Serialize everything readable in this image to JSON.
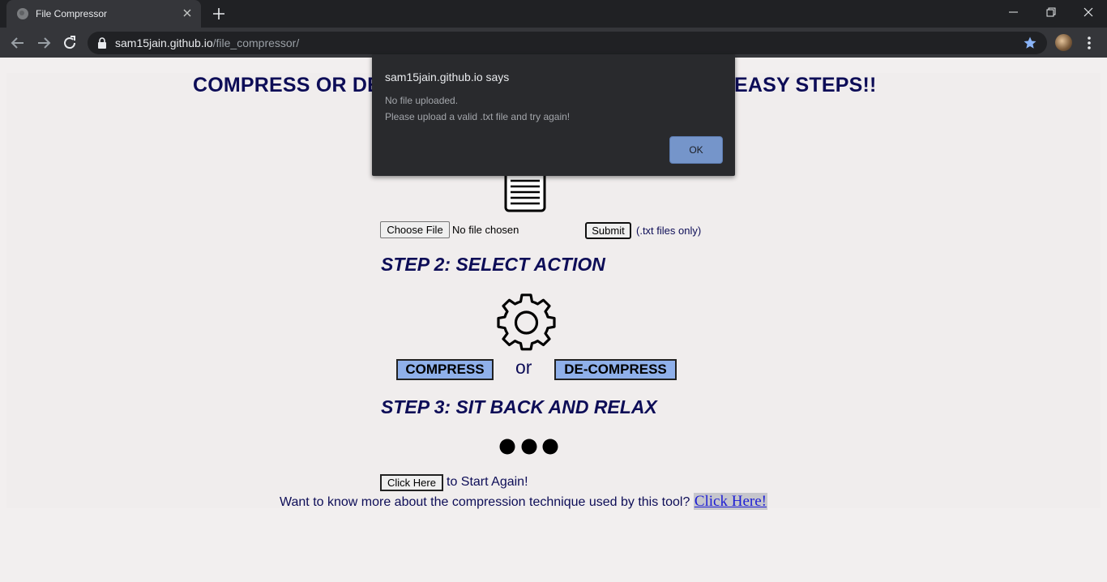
{
  "browser": {
    "tab_title": "File Compressor",
    "url_host": "sam15jain.github.io",
    "url_path": "/file_compressor/"
  },
  "page": {
    "headline": "COMPRESS OR DECOMPRESS YOUR FILES IN THREE EASY STEPS!!",
    "file_input": {
      "button_label": "Choose File",
      "status": "No file chosen"
    },
    "submit_label": "Submit",
    "txt_only_note": "(.txt files only)",
    "step2": "STEP 2: SELECT  ACTION",
    "compress_label": "COMPRESS",
    "or_text": "or",
    "decompress_label": "DE-COMPRESS",
    "step3": "STEP 3: SIT BACK AND RELAX",
    "start_again_button": "Click Here",
    "start_again_text": "to Start Again!",
    "know_more_text": "Want to know more about the compression technique used by this tool?",
    "know_more_link": "Click Here!"
  },
  "dialog": {
    "title": "sam15jain.github.io says",
    "line1": "No file uploaded.",
    "line2": "Please upload a valid .txt file and try again!",
    "ok_label": "OK"
  },
  "colors": {
    "heading": "#0d0d57",
    "action_button": "#8fb0ea",
    "dialog_bg": "#292a2d",
    "dialog_ok": "#7595ca",
    "star": "#8ab4f8"
  },
  "icons": [
    "globe-icon",
    "close-icon",
    "plus-icon",
    "minimize-icon",
    "restore-icon",
    "window-close-icon",
    "back-arrow-icon",
    "forward-arrow-icon",
    "reload-icon",
    "lock-icon",
    "star-icon",
    "avatar",
    "more-menu-icon",
    "document-icon",
    "gear-icon",
    "dots-icon"
  ]
}
